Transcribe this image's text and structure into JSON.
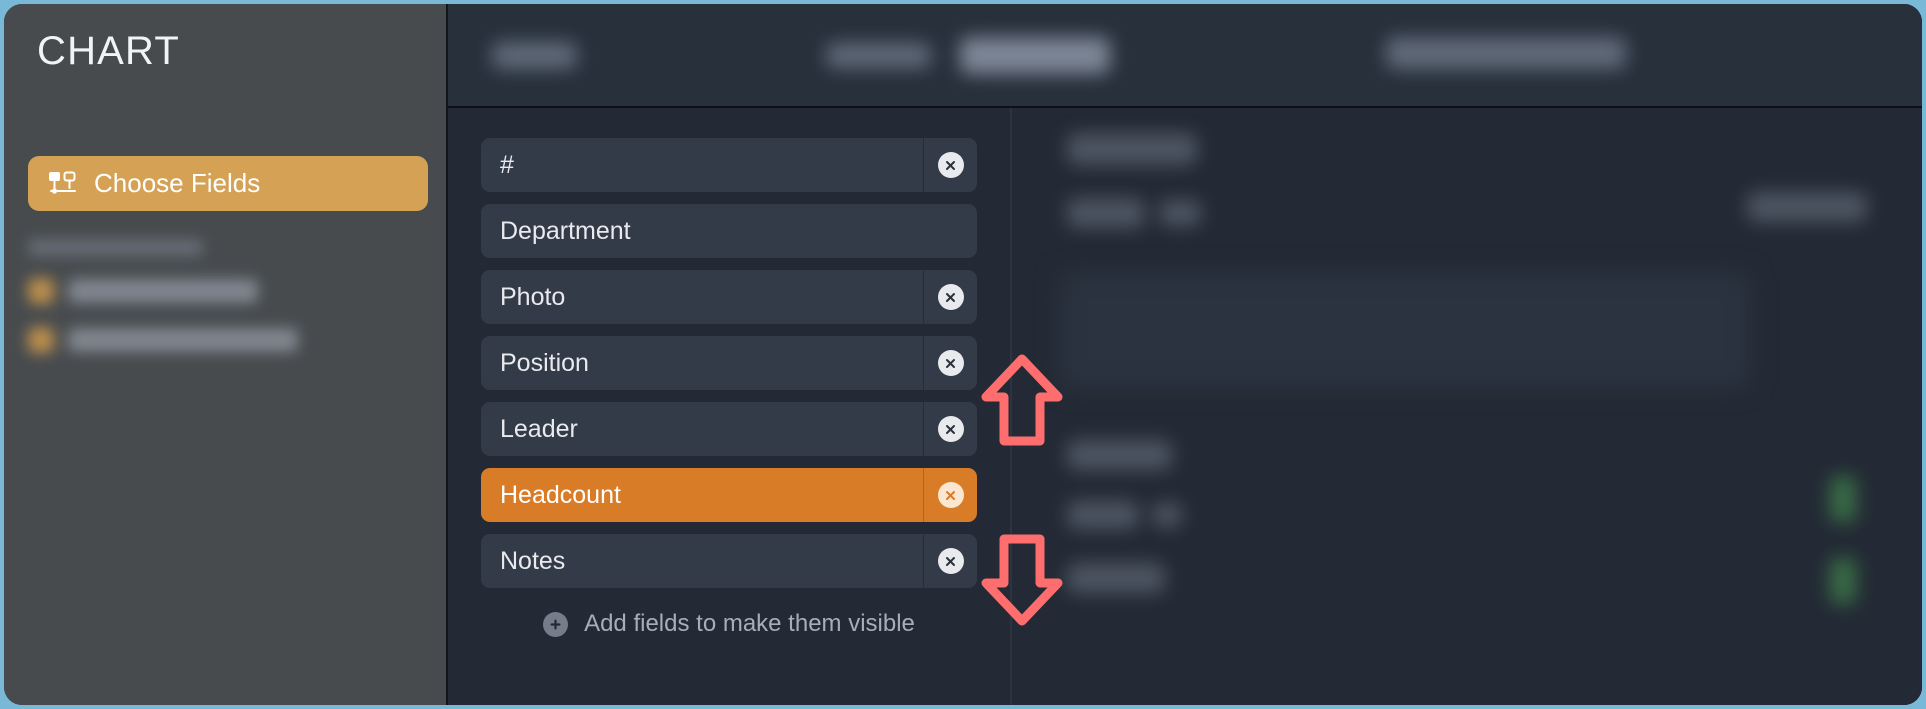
{
  "app": {
    "title": "CHART",
    "accent_orange": "#d5a155",
    "selected_orange": "#d97c28",
    "page_background": "#7ab8d8",
    "panel_background": "#232a35",
    "sidebar_background": "#474b4e"
  },
  "sidebar": {
    "title": "CHART",
    "choose_fields": {
      "label": "Choose Fields",
      "icon": "fields-chart-icon"
    }
  },
  "fields_panel": {
    "rows": [
      {
        "label": "#",
        "removable": true,
        "selected": false
      },
      {
        "label": "Department",
        "removable": false,
        "selected": false
      },
      {
        "label": "Photo",
        "removable": true,
        "selected": false
      },
      {
        "label": "Position",
        "removable": true,
        "selected": false
      },
      {
        "label": "Leader",
        "removable": true,
        "selected": false
      },
      {
        "label": "Headcount",
        "removable": true,
        "selected": true
      },
      {
        "label": "Notes",
        "removable": true,
        "selected": false
      }
    ],
    "add_fields": {
      "label": "Add fields to make them visible",
      "icon": "plus-circle-icon"
    }
  },
  "annotations": {
    "color": "#ff6e6e",
    "arrows": [
      {
        "direction": "up",
        "name": "scroll-up-arrow-annotation"
      },
      {
        "direction": "down",
        "name": "scroll-down-arrow-annotation"
      }
    ]
  }
}
